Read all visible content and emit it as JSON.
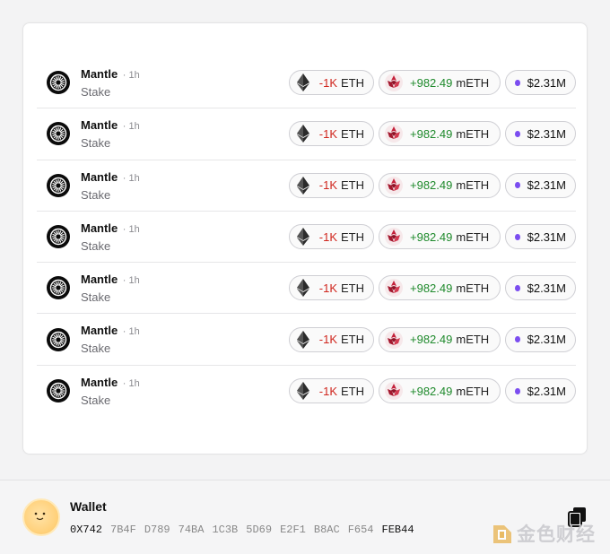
{
  "transactions": [
    {
      "protocol": "Mantle",
      "time": "· 1h",
      "action": "Stake",
      "sent_amount": "-1K",
      "sent_token": "ETH",
      "received_amount": "+982.49",
      "received_token": "mETH",
      "value": "$2.31M"
    },
    {
      "protocol": "Mantle",
      "time": "· 1h",
      "action": "Stake",
      "sent_amount": "-1K",
      "sent_token": "ETH",
      "received_amount": "+982.49",
      "received_token": "mETH",
      "value": "$2.31M"
    },
    {
      "protocol": "Mantle",
      "time": "· 1h",
      "action": "Stake",
      "sent_amount": "-1K",
      "sent_token": "ETH",
      "received_amount": "+982.49",
      "received_token": "mETH",
      "value": "$2.31M"
    },
    {
      "protocol": "Mantle",
      "time": "· 1h",
      "action": "Stake",
      "sent_amount": "-1K",
      "sent_token": "ETH",
      "received_amount": "+982.49",
      "received_token": "mETH",
      "value": "$2.31M"
    },
    {
      "protocol": "Mantle",
      "time": "· 1h",
      "action": "Stake",
      "sent_amount": "-1K",
      "sent_token": "ETH",
      "received_amount": "+982.49",
      "received_token": "mETH",
      "value": "$2.31M"
    },
    {
      "protocol": "Mantle",
      "time": "· 1h",
      "action": "Stake",
      "sent_amount": "-1K",
      "sent_token": "ETH",
      "received_amount": "+982.49",
      "received_token": "mETH",
      "value": "$2.31M"
    },
    {
      "protocol": "Mantle",
      "time": "· 1h",
      "action": "Stake",
      "sent_amount": "-1K",
      "sent_token": "ETH",
      "received_amount": "+982.49",
      "received_token": "mETH",
      "value": "$2.31M"
    }
  ],
  "icons": {
    "protocol": "mantle-logo-icon",
    "sent": "eth-icon",
    "received": "meth-icon",
    "value": "purple-dot-icon",
    "copy": "copy-icon"
  },
  "colors": {
    "negative": "#d0261e",
    "positive": "#1f8a2c",
    "value_dot": "#7b4df0"
  },
  "wallet": {
    "label": "Wallet",
    "address_groups": [
      "0X742",
      "7B4F",
      "D789",
      "74BA",
      "1C3B",
      "5D69",
      "E2F1",
      "B8AC",
      "F654",
      "FEB44"
    ]
  },
  "watermark": {
    "text": "金色财经"
  }
}
